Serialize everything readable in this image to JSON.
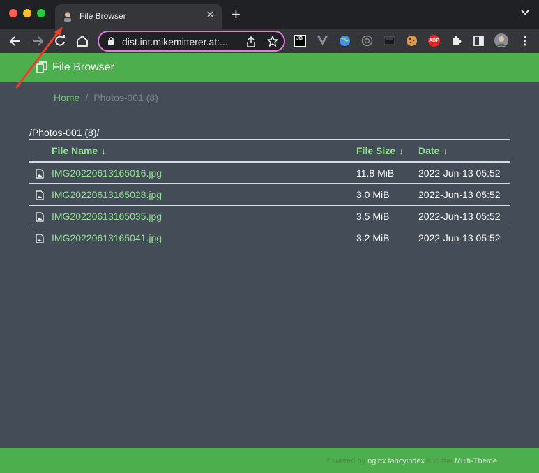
{
  "browser": {
    "tab": {
      "title": "File Browser",
      "close_icon": "close-icon"
    },
    "new_tab_label": "+",
    "url": "dist.int.mikemitterer.at:...",
    "extensions": [
      "jetbrains-icon",
      "vue-icon",
      "globe-icon",
      "proxy-icon",
      "screen-icon",
      "cookie-icon",
      "adblock-icon",
      "puzzle-icon",
      "sidepanel-icon",
      "profile-avatar"
    ],
    "adblock_label": "ABP",
    "jb_label": "JB"
  },
  "app": {
    "title": "File Browser",
    "header_color": "#4cae4c",
    "link_color": "#8ee28e"
  },
  "breadcrumb": {
    "home": "Home",
    "separator": "/",
    "current": "Photos-001 (8)"
  },
  "listing": {
    "path": "/Photos-001 (8)/",
    "columns": {
      "name": "File Name",
      "size": "File Size",
      "date": "Date",
      "sort_arrow": "↓"
    },
    "files": [
      {
        "name": "IMG20220613165016.jpg",
        "size": "11.8 MiB",
        "date": "2022-Jun-13 05:52"
      },
      {
        "name": "IMG20220613165028.jpg",
        "size": "3.0 MiB",
        "date": "2022-Jun-13 05:52"
      },
      {
        "name": "IMG20220613165035.jpg",
        "size": "3.5 MiB",
        "date": "2022-Jun-13 05:52"
      },
      {
        "name": "IMG20220613165041.jpg",
        "size": "3.2 MiB",
        "date": "2022-Jun-13 05:52"
      }
    ]
  },
  "footer": {
    "powered_by": "Powered by",
    "nginx": "nginx",
    "fancyindex": "fancyindex",
    "and_the": "and the",
    "multi_theme": "Multi-Theme"
  }
}
